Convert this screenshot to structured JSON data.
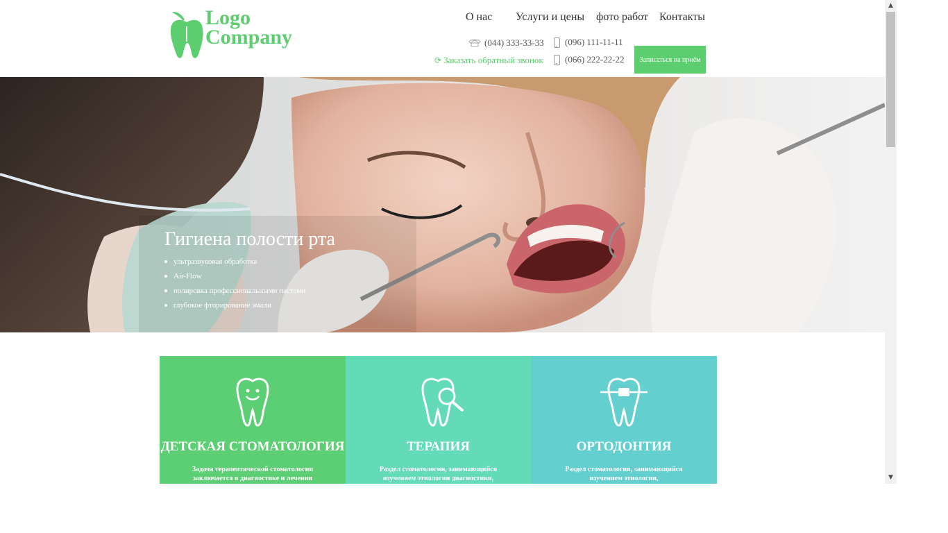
{
  "header": {
    "logo": {
      "line1": "Logo",
      "line2": "Company"
    },
    "nav": [
      "О нас",
      "Услуги и цены",
      "фото работ",
      "Контакты"
    ],
    "phones": {
      "landline": "(044) 333-33-33",
      "mobile1": "(096) 111-11-11",
      "mobile2": "(066) 222-22-22"
    },
    "callback_label": "Заказать обратный звонок",
    "book_button": "Записаться на приём"
  },
  "hero": {
    "title": "Гигиена полости рта",
    "items": [
      "ультразвуковая обработка",
      "Air-Flow",
      "полировка профессиональными пастами",
      "глубокое фторирование эмали"
    ]
  },
  "cards": [
    {
      "title": "ДЕТСКАЯ СТОМАТОЛОГИЯ",
      "desc": "Задача терапевтической стоматологии заключается в диагностике и лечении",
      "color": "#5ccf74"
    },
    {
      "title": "ТЕРАПИЯ",
      "desc": "Раздел стоматологии, занимающийся изучением этиологии диагностики, методов",
      "color": "#63dbb6"
    },
    {
      "title": "ОРТОДОНТИЯ",
      "desc": "Раздел стоматологии, занимающийся изучением этиологии, диагностики,методов",
      "color": "#63cfcf"
    }
  ],
  "colors": {
    "accent": "#5cce6f"
  }
}
